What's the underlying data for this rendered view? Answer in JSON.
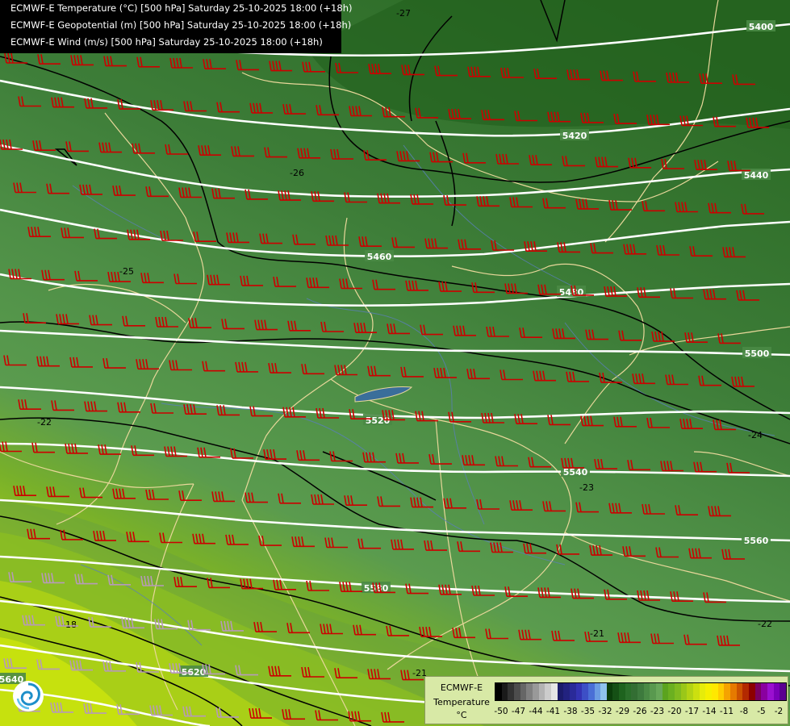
{
  "titles": [
    "ECMWF-E Temperature (°C) [500 hPa] Saturday 25-10-2025 18:00 (+18h)",
    "ECMWF-E Geopotential (m) [500 hPa] Saturday 25-10-2025 18:00 (+18h)",
    "ECMWF-E Wind (m/s) [500 hPa] Saturday 25-10-2025 18:00 (+18h)"
  ],
  "legend": {
    "model": "ECMWF-E",
    "variable": "Temperature",
    "unit": "°C",
    "tick_labels": [
      "-50",
      "-47",
      "-44",
      "-41",
      "-38",
      "-35",
      "-32",
      "-29",
      "-26",
      "-23",
      "-20",
      "-17",
      "-14",
      "-11",
      "-8",
      "-5",
      "-2"
    ],
    "colors": [
      "#000000",
      "#1a1a1a",
      "#333333",
      "#4d4d4d",
      "#666666",
      "#808080",
      "#999999",
      "#b3b3b3",
      "#cccccc",
      "#e6e6e6",
      "#1b1b6b",
      "#22227f",
      "#2a2a99",
      "#3333b3",
      "#3d4fc6",
      "#4a6fd6",
      "#6b9ce3",
      "#8fc3ef",
      "#0b3d0b",
      "#155015",
      "#1e631e",
      "#2a6f2a",
      "#336e33",
      "#3d7a3d",
      "#4a8a45",
      "#59994f",
      "#68a85a",
      "#5ba31e",
      "#6bb020",
      "#80bb1f",
      "#9ac719",
      "#b3d314",
      "#cce00f",
      "#e6ec0a",
      "#f5f000",
      "#ffe800",
      "#ffcc00",
      "#f5a300",
      "#e67a00",
      "#cc5200",
      "#b32900",
      "#8c0000",
      "#7a0060",
      "#8a00a0",
      "#9a10d0",
      "#7b00b8",
      "#5a0090"
    ]
  },
  "contour_labels": {
    "geopotential": [
      "5400",
      "5420",
      "5440",
      "5460",
      "5480",
      "5500",
      "5520",
      "5540",
      "5560",
      "5580",
      "5620",
      "5640"
    ],
    "temperature": [
      "-27",
      "-26",
      "-25",
      "-22",
      "-24",
      "-23",
      "-22",
      "-21",
      "-18",
      "-21"
    ]
  },
  "colors": {
    "wind_barb": "#cc0000",
    "wind_barb_light": "#b69ab8",
    "geopotential_line": "#ffffff",
    "temperature_line": "#000000",
    "border_line": "#e8d79a",
    "river_line": "#5a7fb8"
  },
  "icons": {
    "logo": "ecmwf-swirl-logo-icon"
  }
}
